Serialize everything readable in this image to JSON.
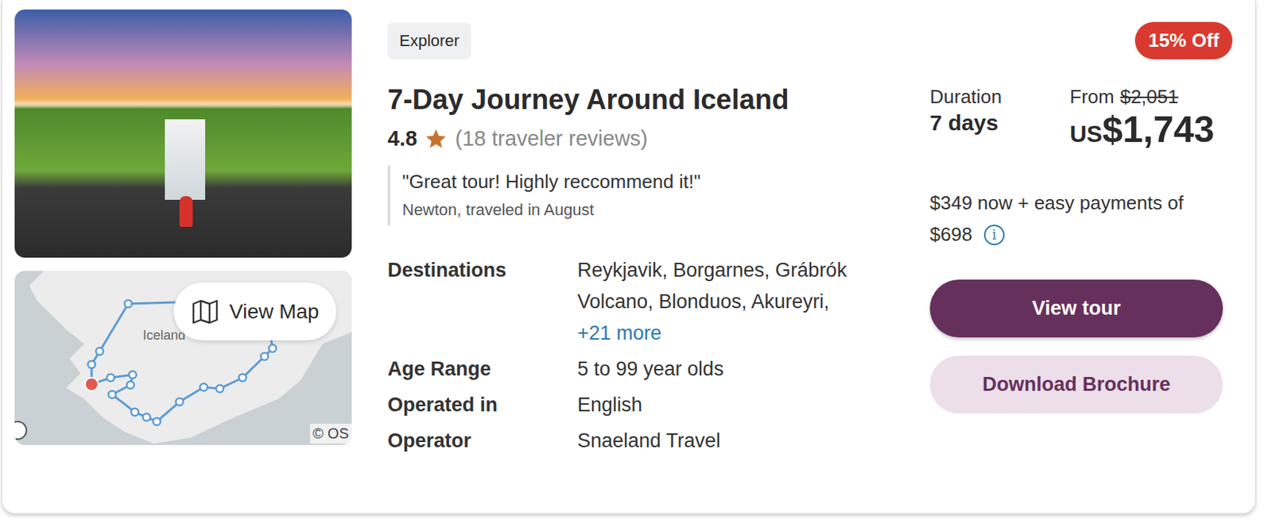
{
  "map": {
    "label": "Iceland",
    "attribution": "© OS",
    "view_button": "View Map"
  },
  "tag": "Explorer",
  "title": "7-Day Journey Around Iceland",
  "rating": {
    "score": "4.8",
    "stars": 1,
    "reviews": "(18 traveler reviews)"
  },
  "quote": {
    "text": "\"Great tour! Highly reccommend it!\"",
    "author": "Newton, traveled in August"
  },
  "details": [
    {
      "label": "Destinations",
      "value": "Reykjavik, Borgarnes, Grábrók Volcano, Blonduos, Akureyri,",
      "link": "+21 more"
    },
    {
      "label": "Age Range",
      "value": "5 to 99 year olds",
      "link": ""
    },
    {
      "label": "Operated in",
      "value": "English",
      "link": ""
    },
    {
      "label": "Operator",
      "value": "Snaeland Travel",
      "link": ""
    }
  ],
  "discount": "15% Off",
  "duration": {
    "label": "Duration",
    "value": "7 days"
  },
  "price": {
    "prefix": "From",
    "original": "$2,051",
    "currency": "US",
    "current": "$1,743"
  },
  "payment": {
    "line1": "$349 now + easy payments of",
    "line2": "$698",
    "info_icon": "i"
  },
  "buttons": [
    {
      "label": "View tour",
      "kind": "primary"
    },
    {
      "label": "Download Brochure",
      "kind": "secondary"
    }
  ]
}
